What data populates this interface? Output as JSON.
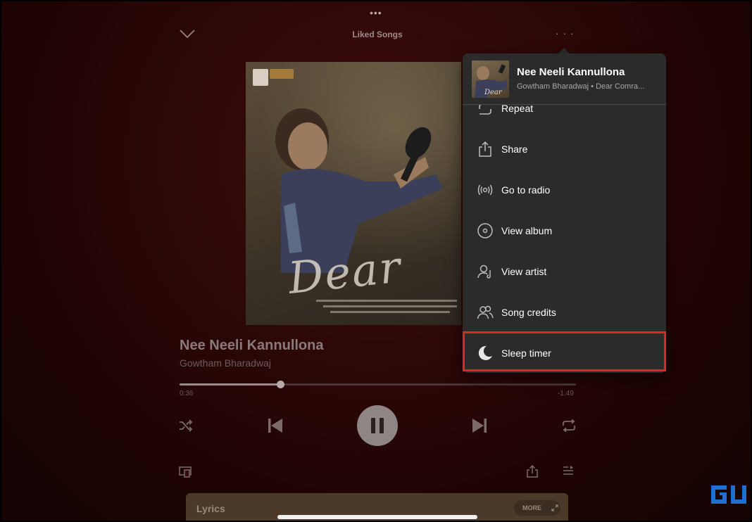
{
  "header": {
    "title": "Liked Songs"
  },
  "now_playing": {
    "song_title": "Nee Neeli Kannullona",
    "artist": "Gowtham Bharadwaj",
    "elapsed": "0:36",
    "remaining": "-1:49",
    "progress_fraction": 0.254
  },
  "album_art": {
    "script_title": "Dear"
  },
  "lyrics": {
    "label": "Lyrics",
    "more_label": "MORE"
  },
  "menu": {
    "song_title": "Nee Neeli Kannullona",
    "subtitle": "Gowtham Bharadwaj • Dear Comra...",
    "items": [
      {
        "label": "Repeat",
        "icon": "repeat-icon"
      },
      {
        "label": "Share",
        "icon": "share-icon"
      },
      {
        "label": "Go to radio",
        "icon": "radio-icon"
      },
      {
        "label": "View album",
        "icon": "album-icon"
      },
      {
        "label": "View artist",
        "icon": "artist-icon"
      },
      {
        "label": "Song credits",
        "icon": "credits-icon"
      },
      {
        "label": "Sleep timer",
        "icon": "moon-icon"
      }
    ],
    "highlighted_item": "Sleep timer",
    "highlight_color": "#e0242b"
  },
  "colors": {
    "background": "#3a0a0a",
    "menu_background": "#2b2b2b",
    "menu_text": "#ffffff"
  }
}
